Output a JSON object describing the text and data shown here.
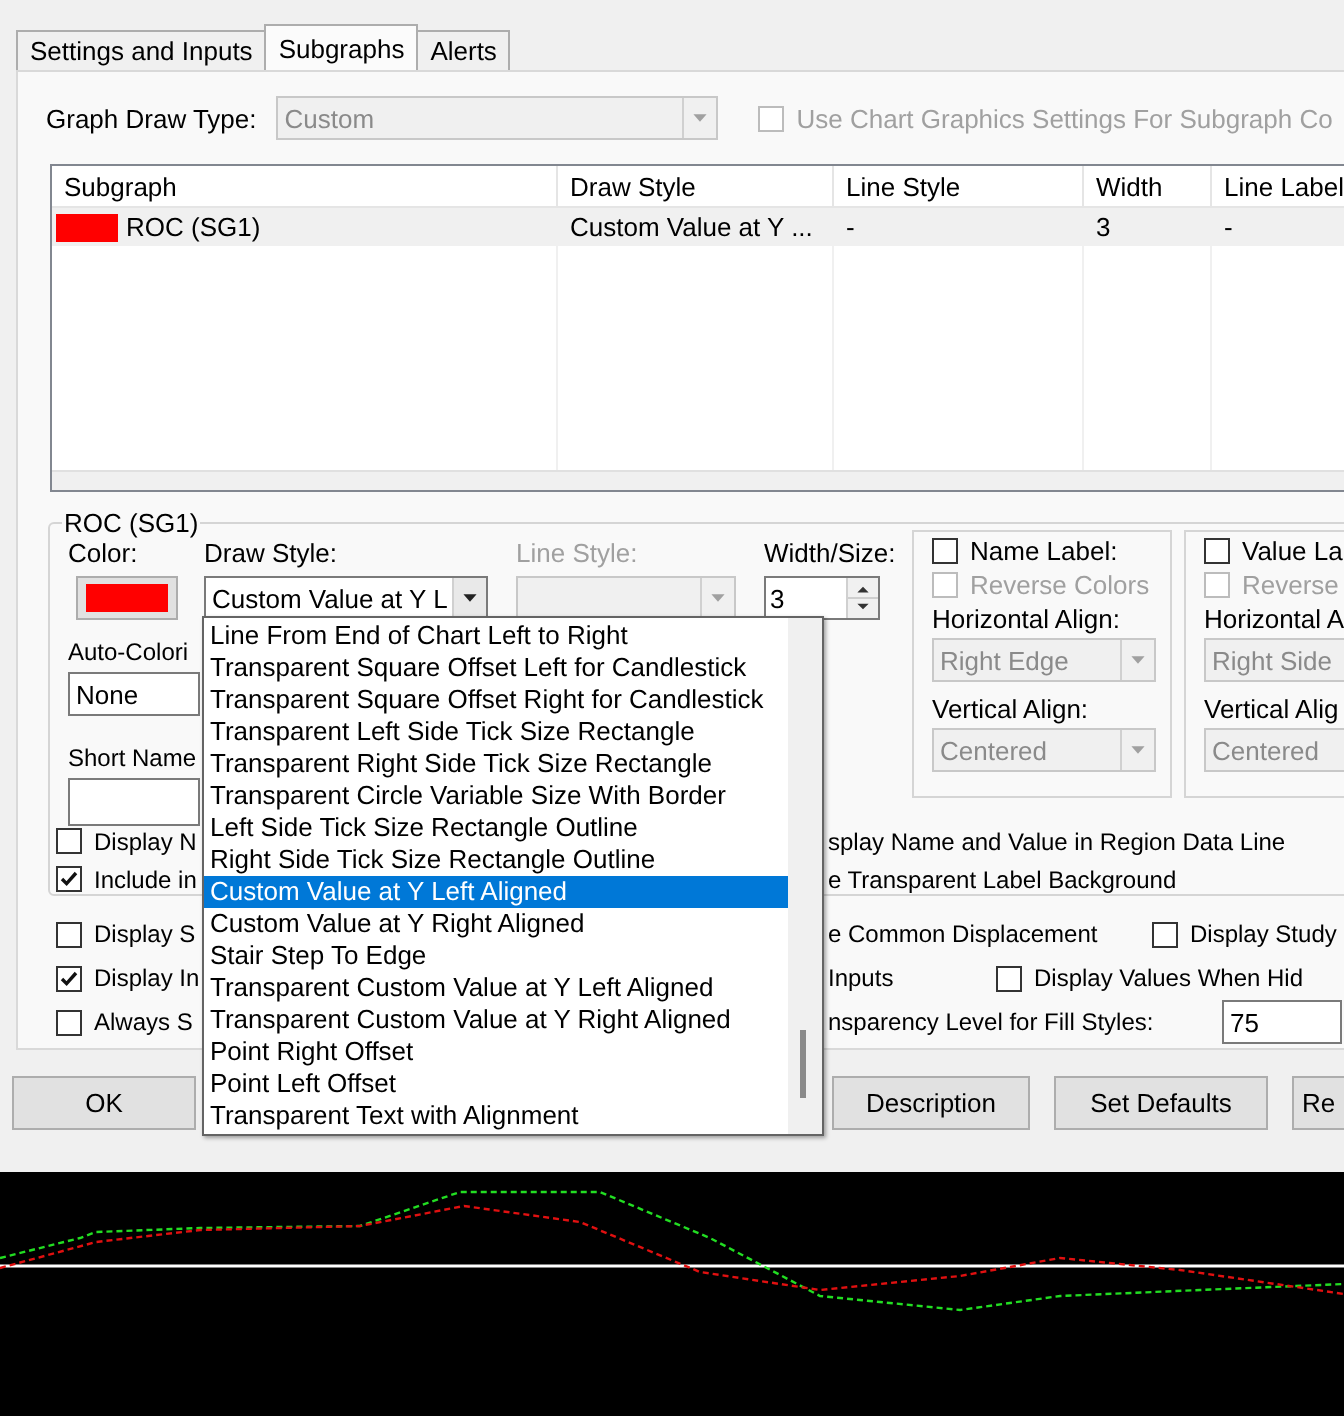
{
  "tabs": [
    {
      "label": "Settings and Inputs",
      "selected": false
    },
    {
      "label": "Subgraphs",
      "selected": true
    },
    {
      "label": "Alerts",
      "selected": false
    }
  ],
  "graph_draw_type": {
    "label": "Graph Draw Type:",
    "value": "Custom",
    "disabled": true
  },
  "use_chart_graphics": {
    "label": "Use Chart Graphics Settings For Subgraph Co",
    "checked": false,
    "disabled": true
  },
  "table": {
    "columns": [
      "Subgraph",
      "Draw Style",
      "Line Style",
      "Width",
      "Line Label"
    ],
    "rows": [
      {
        "color": "#ff0000",
        "cells": [
          "ROC (SG1)",
          "Custom Value at Y ...",
          "-",
          "3",
          "-"
        ]
      }
    ]
  },
  "group": {
    "title": "ROC (SG1)",
    "color_label": "Color:",
    "color": "#ff0000",
    "draw_style_label": "Draw Style:",
    "draw_style_value": "Custom Value at Y L",
    "line_style_label": "Line Style:",
    "line_style_disabled": true,
    "width_label": "Width/Size:",
    "width_value": "3",
    "auto_coloring_label": "Auto-Colori",
    "auto_coloring_value": "None",
    "short_name_label": "Short Name",
    "name_label": {
      "label": "Name Label:",
      "checked": false,
      "reverse_label": "Reverse Colors",
      "reverse_checked": false,
      "h_label": "Horizontal Align:",
      "h_value": "Right Edge",
      "v_label": "Vertical Align:",
      "v_value": "Centered"
    },
    "value_label": {
      "label": "Value La",
      "checked": false,
      "reverse_label": "Reverse",
      "reverse_checked": false,
      "h_label": "Horizontal A",
      "h_value": "Right Side",
      "v_label": "Vertical Alig",
      "v_value": "Centered"
    },
    "options": [
      {
        "label": "Display N",
        "checked": false,
        "right": "splay Name and Value in Region Data Line"
      },
      {
        "label": "Include in",
        "checked": true,
        "right": "e Transparent Label Background"
      }
    ]
  },
  "options": [
    {
      "label": "Display S",
      "checked": false,
      "right": "e Common Displacement",
      "extra": {
        "kind": "checkbox",
        "label": "Display Study",
        "checked": false
      }
    },
    {
      "label": "Display In",
      "checked": true,
      "right": "Inputs",
      "extra": {
        "kind": "checkbox",
        "label": "Display Values When Hid",
        "checked": false
      }
    },
    {
      "label": "Always S",
      "checked": false,
      "right": "nsparency Level for Fill Styles:",
      "extra": {
        "kind": "field",
        "value": "75"
      }
    }
  ],
  "buttons": [
    "OK",
    "Description",
    "Set Defaults",
    "Re"
  ],
  "draw_style_list": {
    "items": [
      {
        "label": "Line From End of Chart Left to Right",
        "selected": false
      },
      {
        "label": "Transparent Square Offset Left for Candlestick",
        "selected": false
      },
      {
        "label": "Transparent Square Offset Right for Candlestick",
        "selected": false
      },
      {
        "label": "Transparent Left Side Tick Size Rectangle",
        "selected": false
      },
      {
        "label": "Transparent Right Side Tick Size Rectangle",
        "selected": false
      },
      {
        "label": "Transparent Circle Variable Size With Border",
        "selected": false
      },
      {
        "label": "Left Side Tick Size Rectangle Outline",
        "selected": false
      },
      {
        "label": "Right Side Tick Size Rectangle Outline",
        "selected": false
      },
      {
        "label": "Custom Value at Y Left Aligned",
        "selected": true
      },
      {
        "label": "Custom Value at Y Right Aligned",
        "selected": false
      },
      {
        "label": "Stair Step To Edge",
        "selected": false
      },
      {
        "label": "Transparent Custom Value at Y Left Aligned",
        "selected": false
      },
      {
        "label": "Transparent Custom Value at Y Right Aligned",
        "selected": false
      },
      {
        "label": "Point Right Offset",
        "selected": false
      },
      {
        "label": "Point Left Offset",
        "selected": false
      },
      {
        "label": "Transparent Text with Alignment",
        "selected": false
      }
    ]
  }
}
